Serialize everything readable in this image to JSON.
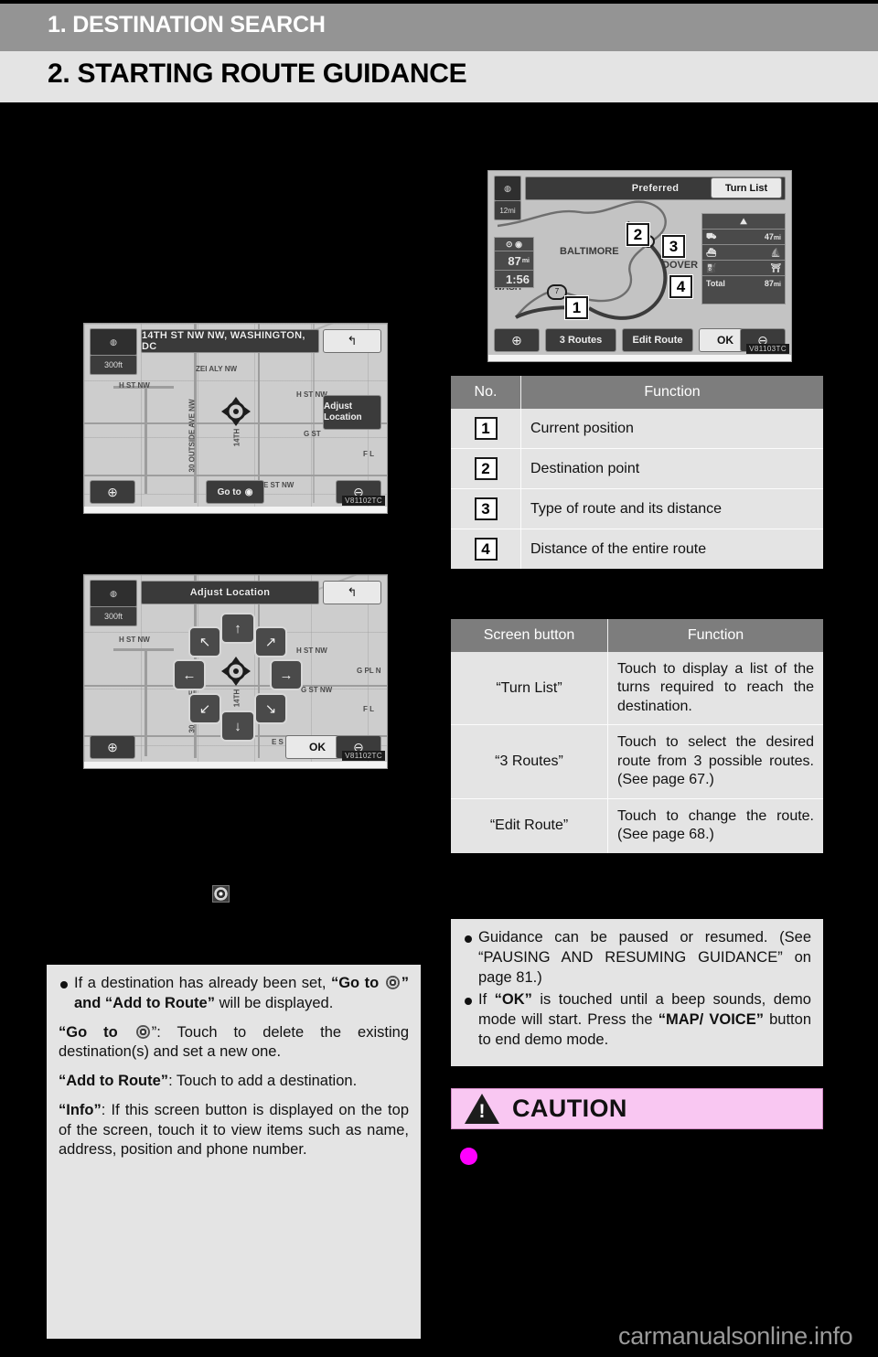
{
  "header": {
    "chapter": "1. DESTINATION SEARCH",
    "section": "2. STARTING ROUTE GUIDANCE"
  },
  "left_column": {
    "map_screen_1": {
      "title": "14TH ST NW NW, WASHINGTON, DC",
      "scale_label": "300ft",
      "adjust_button": "Adjust Location",
      "goto_button": "Go to",
      "zoom_in": "+",
      "zoom_out": "-",
      "code": "V81102TC",
      "street_labels": [
        "H ST NW",
        "ZEI ALY NW",
        "H ST NW",
        "G ST",
        "E ST NW",
        "14TH",
        "E ST NW",
        "F L"
      ]
    },
    "map_screen_2": {
      "title": "Adjust Location",
      "scale_label": "300ft",
      "ok_button": "OK",
      "zoom_in": "+",
      "zoom_out": "-",
      "code": "V81102TC",
      "street_labels": [
        "H ST NW",
        "H ST NW",
        "G PL N",
        "G ST NW",
        "E S",
        "F L",
        "14TH"
      ]
    },
    "lone_icon_name": "destination-target-icon",
    "note": {
      "bullets": [
        {
          "lead": "If a destination has already been set, ",
          "bold1": "“Go to ",
          "mid1": "” and ",
          "bold2": "“Add to Route”",
          "tail": " will be displayed."
        }
      ],
      "paragraphs": [
        {
          "bold": "“Go to ",
          "rest": "”: Touch to delete the existing destination(s) and set a new one."
        },
        {
          "bold": "“Add to Route”",
          "rest": ": Touch to add a destination."
        },
        {
          "bold": "“Info”",
          "rest": ": If this screen button is displayed on the top of the screen, touch it to view items such as name, address, position and phone number."
        }
      ]
    }
  },
  "right_column": {
    "route_screen": {
      "title": "Preferred",
      "turn_list_button": "Turn List",
      "routes_button": "3 Routes",
      "edit_route_button": "Edit Route",
      "ok_button": "OK",
      "zoom_in": "+",
      "zoom_out": "-",
      "scale_label": "12mi",
      "distance": "87",
      "distance_unit": "mi",
      "eta": "1:56",
      "city_labels": [
        "BALTIMORE",
        "DOVER",
        "WASH"
      ],
      "route_distance": "47",
      "route_distance_unit": "mi",
      "total_label": "Total",
      "total_distance": "87",
      "total_unit": "mi",
      "code": "V81103TC",
      "callouts": [
        "1",
        "2",
        "3",
        "4"
      ]
    },
    "table_no": {
      "headers": [
        "No.",
        "Function"
      ],
      "rows": [
        {
          "no": "1",
          "function": "Current position"
        },
        {
          "no": "2",
          "function": "Destination point"
        },
        {
          "no": "3",
          "function": "Type of route and its distance"
        },
        {
          "no": "4",
          "function": "Distance of the entire route"
        }
      ]
    },
    "table_buttons": {
      "headers": [
        "Screen button",
        "Function"
      ],
      "rows": [
        {
          "button": "“Turn List”",
          "function": "Touch to display a list of the turns required to reach the destination."
        },
        {
          "button": "“3 Routes”",
          "function": "Touch to select the desired route from 3 possible routes. (See page 67.)"
        },
        {
          "button": "“Edit Route”",
          "function": "Touch to change the route. (See page 68.)"
        }
      ]
    },
    "note": {
      "bullet1": {
        "part1": "Guidance can be paused or resumed. (See “PAUSING AND RESUMING GUIDANCE” on page 81.)"
      },
      "bullet2": {
        "lead": "If ",
        "bold1": "“OK”",
        "mid": " is touched until a beep sounds, demo mode will start. Press the ",
        "bold2": "“MAP/ VOICE”",
        "tail": " button to end demo mode."
      }
    },
    "caution": {
      "label": "CAUTION"
    }
  },
  "footer": {
    "watermark": "carmanualsonline.info"
  }
}
